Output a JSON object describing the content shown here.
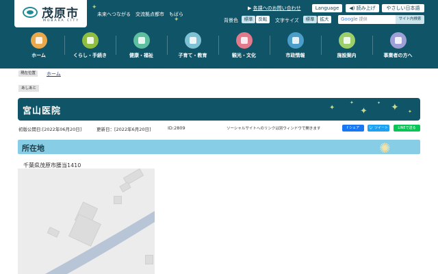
{
  "header": {
    "logo_text": "茂原市",
    "logo_sub": "MOBARA CITY",
    "tagline": [
      "未来へつながる",
      "交流拠点都市",
      "もばら"
    ],
    "links": {
      "inquiry": "各課へのお問い合わせ",
      "language": "Language",
      "read_aloud": "読み上げ",
      "easy_japanese": "やさしい日本語"
    },
    "background_color_label": "背景色",
    "background_options": [
      "標準",
      "反転"
    ],
    "text_size_label": "文字サイズ",
    "text_size_options": [
      "標準",
      "拡大"
    ],
    "search": {
      "brand": "Google",
      "placeholder": "提供",
      "button": "サイト内検索"
    }
  },
  "nav": [
    {
      "label": "ホーム",
      "color": "#e9a84b"
    },
    {
      "label": "くらし・手続き",
      "color": "#8fbd3f"
    },
    {
      "label": "健康・福祉",
      "color": "#5dbf9e"
    },
    {
      "label": "子育て・教育",
      "color": "#7fc1d4"
    },
    {
      "label": "観光・文化",
      "color": "#e2798c"
    },
    {
      "label": "市政情報",
      "color": "#4a9ec9"
    },
    {
      "label": "施設案内",
      "color": "#9ccf6a"
    },
    {
      "label": "事業者の方へ",
      "color": "#9d9fd6"
    }
  ],
  "breadcrumb": {
    "label": "現在位置",
    "home": "ホーム"
  },
  "footprint": "あしあと",
  "page_title": "宮山医院",
  "meta": {
    "published": "初版公開日:[2022年06月20日]",
    "updated": "更新日：[2022年6月20日]",
    "id": "ID:2809"
  },
  "sns": {
    "note": "ソーシャルサイトへのリンクは別ウィンドウで開きます",
    "facebook": "シェア",
    "twitter": "ツイート",
    "line": "LINEで送る"
  },
  "section": {
    "title": "所在地",
    "address": "千葉県茂原市腰当1410"
  },
  "colors": {
    "header_bg": "#0f5467",
    "section_bg": "#86cde5"
  }
}
